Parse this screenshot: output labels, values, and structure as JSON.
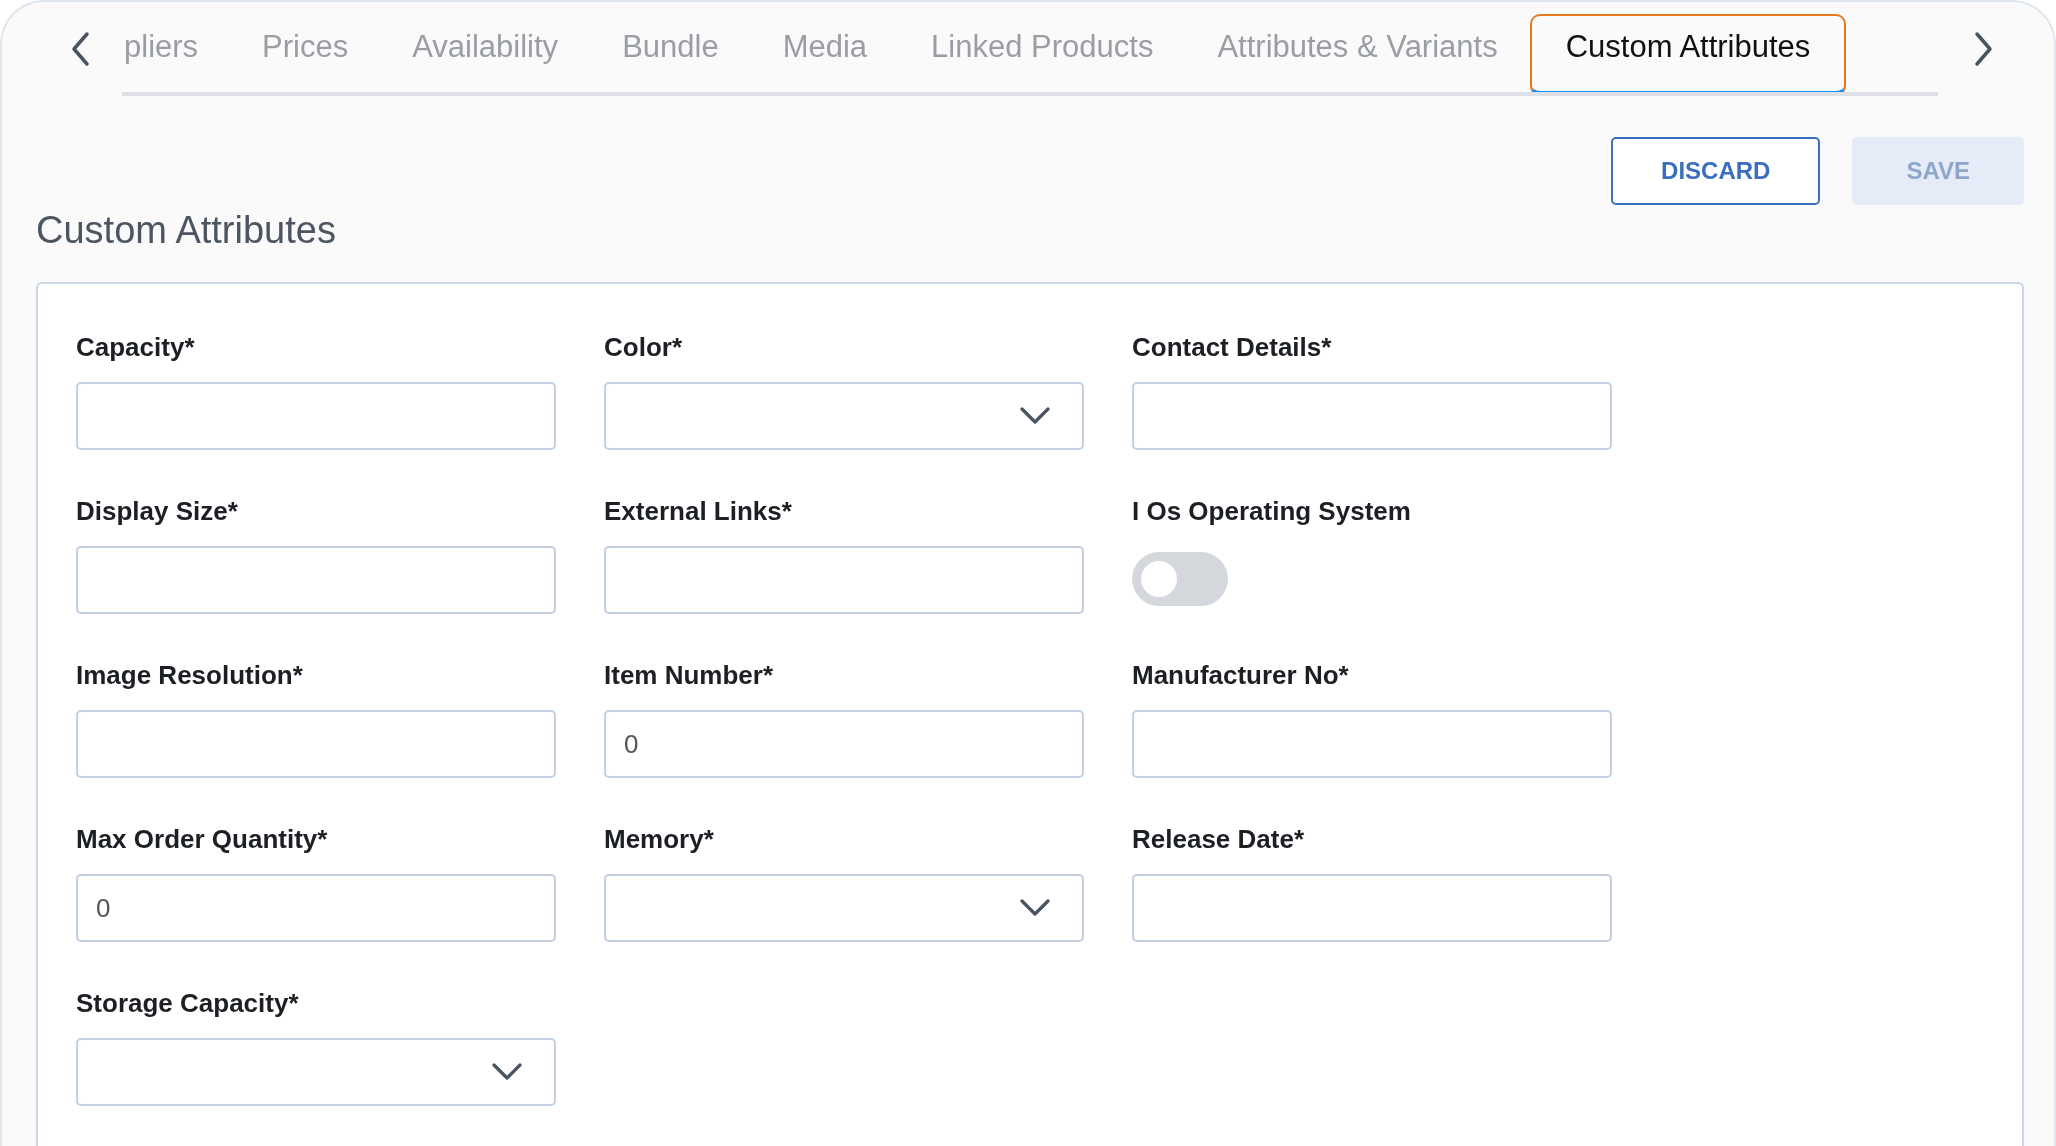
{
  "tabs": [
    {
      "label": "pliers",
      "selected": false
    },
    {
      "label": "Prices",
      "selected": false
    },
    {
      "label": "Availability",
      "selected": false
    },
    {
      "label": "Bundle",
      "selected": false
    },
    {
      "label": "Media",
      "selected": false
    },
    {
      "label": "Linked Products",
      "selected": false
    },
    {
      "label": "Attributes & Variants",
      "selected": false
    },
    {
      "label": "Custom Attributes",
      "selected": true
    }
  ],
  "actions": [
    {
      "label": "DISCARD",
      "disabled": false
    },
    {
      "label": "SAVE",
      "disabled": true
    }
  ],
  "section": {
    "title": "Custom Attributes"
  },
  "fields": [
    {
      "label": "Capacity*",
      "kind": "text"
    },
    {
      "label": "Color*",
      "kind": "select"
    },
    {
      "label": "Contact Details*",
      "kind": "text"
    },
    {
      "label": "Display Size*",
      "kind": "text"
    },
    {
      "label": "External Links*",
      "kind": "text"
    },
    {
      "label": "I Os Operating System",
      "kind": "toggle",
      "on": false
    },
    {
      "label": "Image Resolution*",
      "kind": "text"
    },
    {
      "label": "Item Number*",
      "kind": "text",
      "value": "0"
    },
    {
      "label": "Manufacturer No*",
      "kind": "text"
    },
    {
      "label": "Max Order Quantity*",
      "kind": "text",
      "value": "0"
    },
    {
      "label": "Memory*",
      "kind": "select"
    },
    {
      "label": "Release Date*",
      "kind": "text"
    },
    {
      "label": "Storage Capacity*",
      "kind": "select"
    }
  ]
}
